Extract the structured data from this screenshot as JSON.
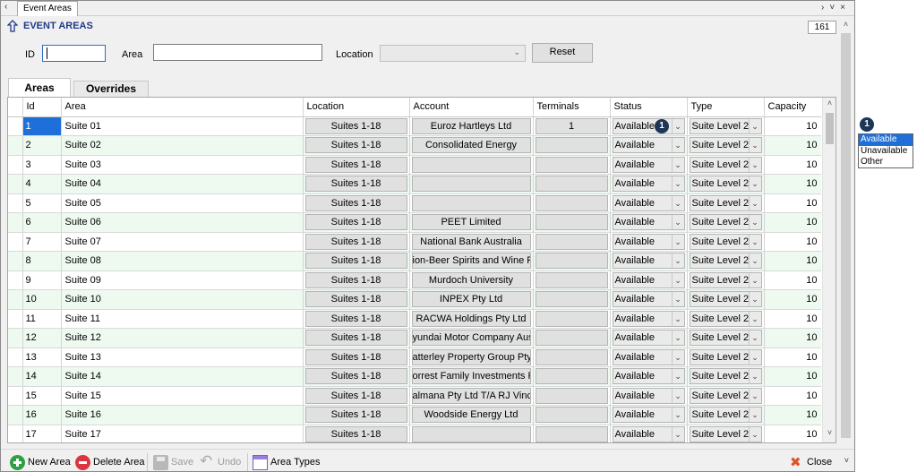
{
  "window": {
    "tab_title": "Event Areas",
    "page_title": "EVENT AREAS",
    "record_count": "161"
  },
  "filters": {
    "id_label": "ID",
    "id_value": "",
    "area_label": "Area",
    "area_value": "",
    "location_label": "Location",
    "location_value": "",
    "reset_label": "Reset"
  },
  "tabs": [
    {
      "label": "Areas",
      "active": true
    },
    {
      "label": "Overrides",
      "active": false
    }
  ],
  "grid": {
    "columns": [
      "Id",
      "Area",
      "Location",
      "Account",
      "Terminals",
      "Status",
      "Type",
      "Capacity"
    ],
    "rows": [
      {
        "id": "1",
        "area": "Suite 01",
        "location": "Suites 1-18",
        "account": "Euroz Hartleys Ltd",
        "terminals": "1",
        "status": "Available",
        "type": "Suite Level 2",
        "capacity": "10"
      },
      {
        "id": "2",
        "area": "Suite 02",
        "location": "Suites 1-18",
        "account": "Consolidated Energy",
        "terminals": "",
        "status": "Available",
        "type": "Suite Level 2",
        "capacity": "10"
      },
      {
        "id": "3",
        "area": "Suite 03",
        "location": "Suites 1-18",
        "account": "",
        "terminals": "",
        "status": "Available",
        "type": "Suite Level 2",
        "capacity": "10"
      },
      {
        "id": "4",
        "area": "Suite 04",
        "location": "Suites 1-18",
        "account": "",
        "terminals": "",
        "status": "Available",
        "type": "Suite Level 2",
        "capacity": "10"
      },
      {
        "id": "5",
        "area": "Suite 05",
        "location": "Suites 1-18",
        "account": "",
        "terminals": "",
        "status": "Available",
        "type": "Suite Level 2",
        "capacity": "10"
      },
      {
        "id": "6",
        "area": "Suite 06",
        "location": "Suites 1-18",
        "account": "PEET Limited",
        "terminals": "",
        "status": "Available",
        "type": "Suite Level 2",
        "capacity": "10"
      },
      {
        "id": "7",
        "area": "Suite 07",
        "location": "Suites 1-18",
        "account": "National Bank Australia",
        "terminals": "",
        "status": "Available",
        "type": "Suite Level 2",
        "capacity": "10"
      },
      {
        "id": "8",
        "area": "Suite 08",
        "location": "Suites 1-18",
        "account": "ion-Beer Spirits and Wine Pty",
        "terminals": "",
        "status": "Available",
        "type": "Suite Level 2",
        "capacity": "10"
      },
      {
        "id": "9",
        "area": "Suite 09",
        "location": "Suites 1-18",
        "account": "Murdoch University",
        "terminals": "",
        "status": "Available",
        "type": "Suite Level 2",
        "capacity": "10"
      },
      {
        "id": "10",
        "area": "Suite 10",
        "location": "Suites 1-18",
        "account": "INPEX Pty Ltd",
        "terminals": "",
        "status": "Available",
        "type": "Suite Level 2",
        "capacity": "10"
      },
      {
        "id": "11",
        "area": "Suite 11",
        "location": "Suites 1-18",
        "account": "RACWA Holdings Pty Ltd",
        "terminals": "",
        "status": "Available",
        "type": "Suite Level 2",
        "capacity": "10"
      },
      {
        "id": "12",
        "area": "Suite 12",
        "location": "Suites 1-18",
        "account": "yundai Motor Company Aus",
        "terminals": "",
        "status": "Available",
        "type": "Suite Level 2",
        "capacity": "10"
      },
      {
        "id": "13",
        "area": "Suite 13",
        "location": "Suites 1-18",
        "account": "atterley Property Group Pty l",
        "terminals": "",
        "status": "Available",
        "type": "Suite Level 2",
        "capacity": "10"
      },
      {
        "id": "14",
        "area": "Suite 14",
        "location": "Suites 1-18",
        "account": "orrest Family Investments Pt",
        "terminals": "",
        "status": "Available",
        "type": "Suite Level 2",
        "capacity": "10"
      },
      {
        "id": "15",
        "area": "Suite 15",
        "location": "Suites 1-18",
        "account": "almana Pty Ltd T/A RJ Vincer",
        "terminals": "",
        "status": "Available",
        "type": "Suite Level 2",
        "capacity": "10"
      },
      {
        "id": "16",
        "area": "Suite 16",
        "location": "Suites 1-18",
        "account": "Woodside Energy Ltd",
        "terminals": "",
        "status": "Available",
        "type": "Suite Level 2",
        "capacity": "10"
      },
      {
        "id": "17",
        "area": "Suite 17",
        "location": "Suites 1-18",
        "account": "",
        "terminals": "",
        "status": "Available",
        "type": "Suite Level 2",
        "capacity": "10"
      }
    ]
  },
  "callout": {
    "number": "1"
  },
  "status_dropdown": {
    "options": [
      "Available",
      "Unavailable",
      "Other"
    ],
    "selected": "Available"
  },
  "toolbar": {
    "new_area": "New Area",
    "delete_area": "Delete Area",
    "save": "Save",
    "undo": "Undo",
    "area_types": "Area Types",
    "close": "Close"
  },
  "colors": {
    "title": "#1e3a8a",
    "selection": "#1e6fd9",
    "alt_row": "#eef9f0",
    "badge": "#1d3557"
  }
}
